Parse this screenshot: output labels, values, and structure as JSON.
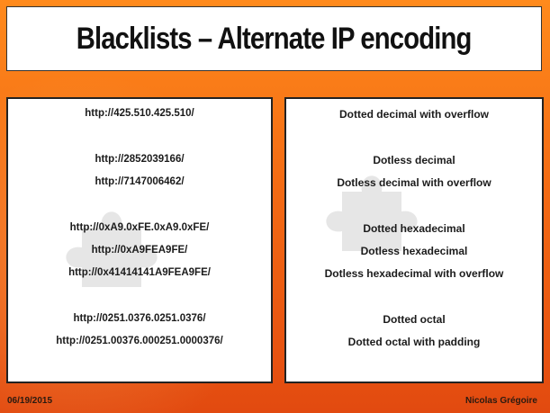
{
  "title": "Blacklists – Alternate IP encoding",
  "left_panel": {
    "items": [
      "http://425.510.425.510/",
      "http://2852039166/",
      "http://7147006462/",
      "http://0xA9.0xFE.0xA9.0xFE/",
      "http://0xA9FEA9FE/",
      "http://0x41414141A9FEA9FE/",
      "http://0251.0376.0251.0376/",
      "http://0251.00376.000251.0000376/"
    ]
  },
  "right_panel": {
    "items": [
      "Dotted decimal with overflow",
      "Dotless decimal",
      "Dotless decimal with overflow",
      "Dotted hexadecimal",
      "Dotless hexadecimal",
      "Dotless hexadecimal with overflow",
      "Dotted octal",
      "Dotted octal with padding"
    ]
  },
  "footer": {
    "date": "06/19/2015",
    "author": "Nicolas Grégoire"
  },
  "colors": {
    "background_top": "#ff8a1c",
    "background_bottom": "#e24a10",
    "panel": "#ffffff",
    "text": "#1b1b1b"
  }
}
